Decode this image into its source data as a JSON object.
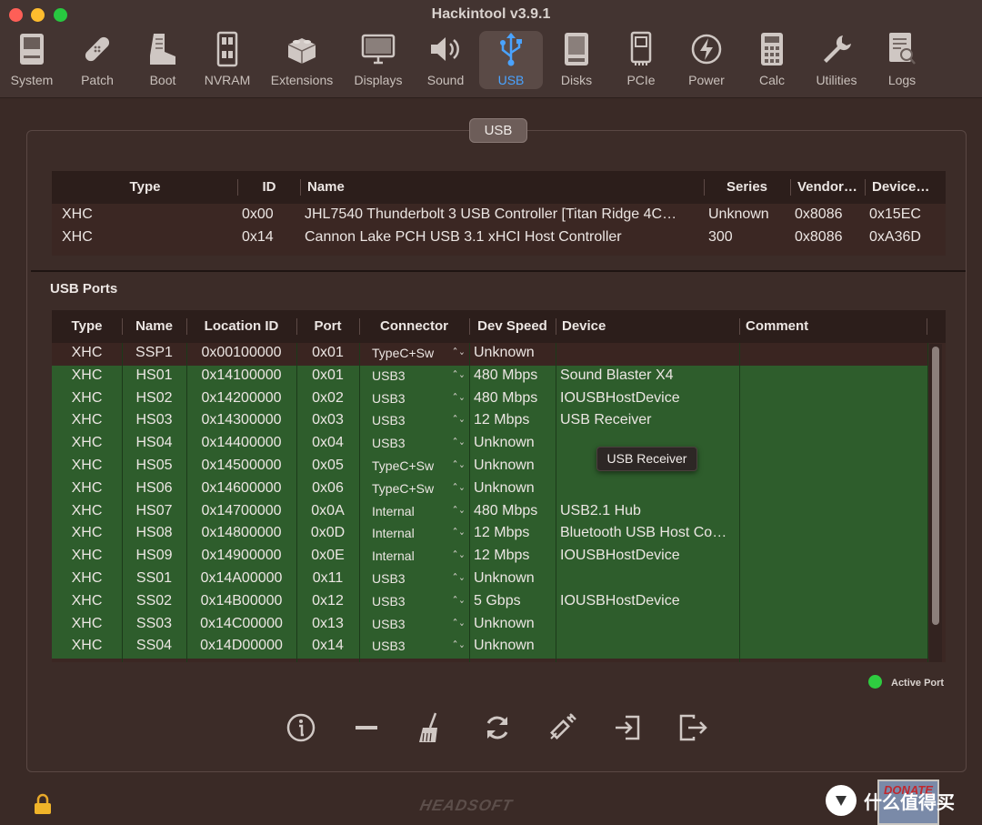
{
  "window": {
    "title": "Hackintool v3.9.1"
  },
  "toolbar": [
    {
      "label": "System",
      "icon": "system-icon"
    },
    {
      "label": "Patch",
      "icon": "bandage-icon"
    },
    {
      "label": "Boot",
      "icon": "boot-icon"
    },
    {
      "label": "NVRAM",
      "icon": "memory-icon"
    },
    {
      "label": "Extensions",
      "icon": "lego-icon"
    },
    {
      "label": "Displays",
      "icon": "monitor-icon"
    },
    {
      "label": "Sound",
      "icon": "speaker-icon"
    },
    {
      "label": "USB",
      "icon": "usb-icon"
    },
    {
      "label": "Disks",
      "icon": "disk-icon"
    },
    {
      "label": "PCIe",
      "icon": "pcie-card-icon"
    },
    {
      "label": "Power",
      "icon": "power-bolt-icon"
    },
    {
      "label": "Calc",
      "icon": "calculator-icon"
    },
    {
      "label": "Utilities",
      "icon": "wrench-icon"
    },
    {
      "label": "Logs",
      "icon": "log-search-icon"
    }
  ],
  "active_tab": "USB",
  "segment_label": "USB",
  "controllers": {
    "headers": [
      "Type",
      "ID",
      "Name",
      "Series",
      "Vendor…",
      "Device…"
    ],
    "rows": [
      [
        "XHC",
        "0x00",
        "JHL7540 Thunderbolt 3 USB Controller [Titan Ridge 4C…",
        "Unknown",
        "0x8086",
        "0x15EC"
      ],
      [
        "XHC",
        "0x14",
        "Cannon Lake PCH USB 3.1 xHCI Host Controller",
        "300",
        "0x8086",
        "0xA36D"
      ]
    ]
  },
  "ports": {
    "section_label": "USB Ports",
    "headers": [
      "Type",
      "Name",
      "Location ID",
      "Port",
      "Connector",
      "Dev Speed",
      "Device",
      "Comment"
    ],
    "rows": [
      {
        "type": "XHC",
        "name": "SSP1",
        "location": "0x00100000",
        "port": "0x01",
        "connector": "TypeC+Sw",
        "speed": "Unknown",
        "device": "",
        "comment": "",
        "active": false
      },
      {
        "type": "XHC",
        "name": "HS01",
        "location": "0x14100000",
        "port": "0x01",
        "connector": "USB3",
        "speed": "480 Mbps",
        "device": "Sound Blaster X4",
        "comment": "",
        "active": true
      },
      {
        "type": "XHC",
        "name": "HS02",
        "location": "0x14200000",
        "port": "0x02",
        "connector": "USB3",
        "speed": "480 Mbps",
        "device": "IOUSBHostDevice",
        "comment": "",
        "active": true
      },
      {
        "type": "XHC",
        "name": "HS03",
        "location": "0x14300000",
        "port": "0x03",
        "connector": "USB3",
        "speed": "12 Mbps",
        "device": "USB Receiver",
        "comment": "",
        "active": true
      },
      {
        "type": "XHC",
        "name": "HS04",
        "location": "0x14400000",
        "port": "0x04",
        "connector": "USB3",
        "speed": "Unknown",
        "device": "",
        "comment": "",
        "active": true
      },
      {
        "type": "XHC",
        "name": "HS05",
        "location": "0x14500000",
        "port": "0x05",
        "connector": "TypeC+Sw",
        "speed": "Unknown",
        "device": "",
        "comment": "",
        "active": true
      },
      {
        "type": "XHC",
        "name": "HS06",
        "location": "0x14600000",
        "port": "0x06",
        "connector": "TypeC+Sw",
        "speed": "Unknown",
        "device": "",
        "comment": "",
        "active": true
      },
      {
        "type": "XHC",
        "name": "HS07",
        "location": "0x14700000",
        "port": "0x0A",
        "connector": "Internal",
        "speed": "480 Mbps",
        "device": "USB2.1 Hub",
        "comment": "",
        "active": true
      },
      {
        "type": "XHC",
        "name": "HS08",
        "location": "0x14800000",
        "port": "0x0D",
        "connector": "Internal",
        "speed": "12 Mbps",
        "device": "Bluetooth USB Host Co…",
        "comment": "",
        "active": true
      },
      {
        "type": "XHC",
        "name": "HS09",
        "location": "0x14900000",
        "port": "0x0E",
        "connector": "Internal",
        "speed": "12 Mbps",
        "device": "IOUSBHostDevice",
        "comment": "",
        "active": true
      },
      {
        "type": "XHC",
        "name": "SS01",
        "location": "0x14A00000",
        "port": "0x11",
        "connector": "USB3",
        "speed": "Unknown",
        "device": "",
        "comment": "",
        "active": true
      },
      {
        "type": "XHC",
        "name": "SS02",
        "location": "0x14B00000",
        "port": "0x12",
        "connector": "USB3",
        "speed": "5 Gbps",
        "device": "IOUSBHostDevice",
        "comment": "",
        "active": true
      },
      {
        "type": "XHC",
        "name": "SS03",
        "location": "0x14C00000",
        "port": "0x13",
        "connector": "USB3",
        "speed": "Unknown",
        "device": "",
        "comment": "",
        "active": true
      },
      {
        "type": "XHC",
        "name": "SS04",
        "location": "0x14D00000",
        "port": "0x14",
        "connector": "USB3",
        "speed": "Unknown",
        "device": "",
        "comment": "",
        "active": true
      }
    ]
  },
  "tooltip": "USB Receiver",
  "legend": {
    "label": "Active Port",
    "color": "#2ecc40"
  },
  "bottom_tools": [
    "info-icon",
    "minus-icon",
    "broom-icon",
    "refresh-icon",
    "syringe-icon",
    "import-icon",
    "export-icon"
  ],
  "footer": {
    "brand": "HEADSOFT",
    "donate": "DONATE",
    "watermark": "什么值得买"
  },
  "colors": {
    "active_row": "#2e5d2c",
    "accent": "#4aa3ff"
  }
}
